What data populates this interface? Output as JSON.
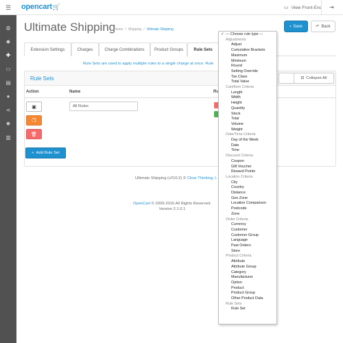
{
  "header": {
    "logo_text": "opencart",
    "logo_cart": "🛒",
    "view_front_label": "View Front-End",
    "menu_glyph": "☰",
    "logout_glyph": "⇥"
  },
  "sidebar": {
    "icons": [
      "dashboard-icon",
      "tags-icon",
      "puzzle-icon",
      "desktop-icon",
      "cart-icon",
      "user-icon",
      "share-icon",
      "gear-icon",
      "bar-chart-icon"
    ],
    "glyphs": [
      "◍",
      "◆",
      "✚",
      "▭",
      "▤",
      "●",
      "⋖",
      "✹",
      "▥"
    ]
  },
  "page": {
    "title": "Ultimate Shipping",
    "breadcrumb": [
      "Home",
      "/",
      "Shipping",
      "/",
      "Ultimate Shipping"
    ],
    "save_label": "Save",
    "back_label": "Back"
  },
  "tabs": [
    {
      "label": "Extension Settings",
      "active": false
    },
    {
      "label": "Charges",
      "active": false
    },
    {
      "label": "Charge Combinations",
      "active": false
    },
    {
      "label": "Product Groups",
      "active": false
    },
    {
      "label": "Rule Sets",
      "active": true
    }
  ],
  "info_text": "Rule Sets are used to apply multiple rules to a single charge at once. Rule",
  "panel": {
    "title": "Rule Sets",
    "expand_label": "nd All",
    "collapse_label": "Collapse All",
    "columns": {
      "action": "Action",
      "name": "Name",
      "rules": "Ru"
    },
    "row": {
      "name_value": "All Rules"
    },
    "add_label": "Add Rule Set"
  },
  "footer": {
    "line1_prefix": "Ultimate Shipping (v210.2) © ",
    "line1_link": "Clear Thinking, L",
    "line2_link": "OpenCart",
    "line2_rest": " © 2009-2016 All Rights Reserved.",
    "line3": "Version 2.1.0.1"
  },
  "dropdown": {
    "items": [
      {
        "t": "--- Choose rule type ---",
        "k": "first"
      },
      {
        "t": "Adjustments",
        "k": "group"
      },
      {
        "t": "Adjust",
        "k": "opt"
      },
      {
        "t": "Cumulative Brackets",
        "k": "opt"
      },
      {
        "t": "Maximum",
        "k": "opt"
      },
      {
        "t": "Minimum",
        "k": "opt"
      },
      {
        "t": "Round",
        "k": "opt"
      },
      {
        "t": "Setting Override",
        "k": "opt"
      },
      {
        "t": "Tax Class",
        "k": "opt"
      },
      {
        "t": "Total Value",
        "k": "opt"
      },
      {
        "t": "Cart/Item Criteria",
        "k": "group"
      },
      {
        "t": "Length",
        "k": "opt"
      },
      {
        "t": "Width",
        "k": "opt"
      },
      {
        "t": "Height",
        "k": "opt"
      },
      {
        "t": "Quantity",
        "k": "opt"
      },
      {
        "t": "Stock",
        "k": "opt"
      },
      {
        "t": "Total",
        "k": "opt"
      },
      {
        "t": "Volume",
        "k": "opt"
      },
      {
        "t": "Weight",
        "k": "opt"
      },
      {
        "t": "Date/Time Criteria",
        "k": "group"
      },
      {
        "t": "Day of the Week",
        "k": "opt"
      },
      {
        "t": "Date",
        "k": "opt"
      },
      {
        "t": "Time",
        "k": "opt"
      },
      {
        "t": "Discount Criteria",
        "k": "group"
      },
      {
        "t": "Coupon",
        "k": "opt"
      },
      {
        "t": "Gift Voucher",
        "k": "opt"
      },
      {
        "t": "Reward Points",
        "k": "opt"
      },
      {
        "t": "Location Criteria",
        "k": "group"
      },
      {
        "t": "City",
        "k": "opt"
      },
      {
        "t": "Country",
        "k": "opt"
      },
      {
        "t": "Distance",
        "k": "opt"
      },
      {
        "t": "Geo Zone",
        "k": "opt"
      },
      {
        "t": "Location Comparison",
        "k": "opt"
      },
      {
        "t": "Postcode",
        "k": "opt"
      },
      {
        "t": "Zone",
        "k": "opt"
      },
      {
        "t": "Order Criteria",
        "k": "group"
      },
      {
        "t": "Currency",
        "k": "opt"
      },
      {
        "t": "Customer",
        "k": "opt"
      },
      {
        "t": "Customer Group",
        "k": "opt"
      },
      {
        "t": "Language",
        "k": "opt"
      },
      {
        "t": "Past Orders",
        "k": "opt"
      },
      {
        "t": "Store",
        "k": "opt"
      },
      {
        "t": "Product Criteria",
        "k": "group"
      },
      {
        "t": "Attribute",
        "k": "opt"
      },
      {
        "t": "Attribute Group",
        "k": "opt"
      },
      {
        "t": "Category",
        "k": "opt"
      },
      {
        "t": "Manufacturer",
        "k": "opt"
      },
      {
        "t": "Option",
        "k": "opt"
      },
      {
        "t": "Product",
        "k": "opt"
      },
      {
        "t": "Product Group",
        "k": "opt"
      },
      {
        "t": "Other Product Data",
        "k": "opt"
      },
      {
        "t": "Rule Sets",
        "k": "group"
      },
      {
        "t": "Rule Set",
        "k": "opt"
      }
    ]
  },
  "colors": {
    "brand_blue": "#1e91cf",
    "sidebar": "#515151",
    "copy_orange": "#f38733",
    "delete_red": "#f56b6b",
    "add_green": "#4caf50"
  }
}
